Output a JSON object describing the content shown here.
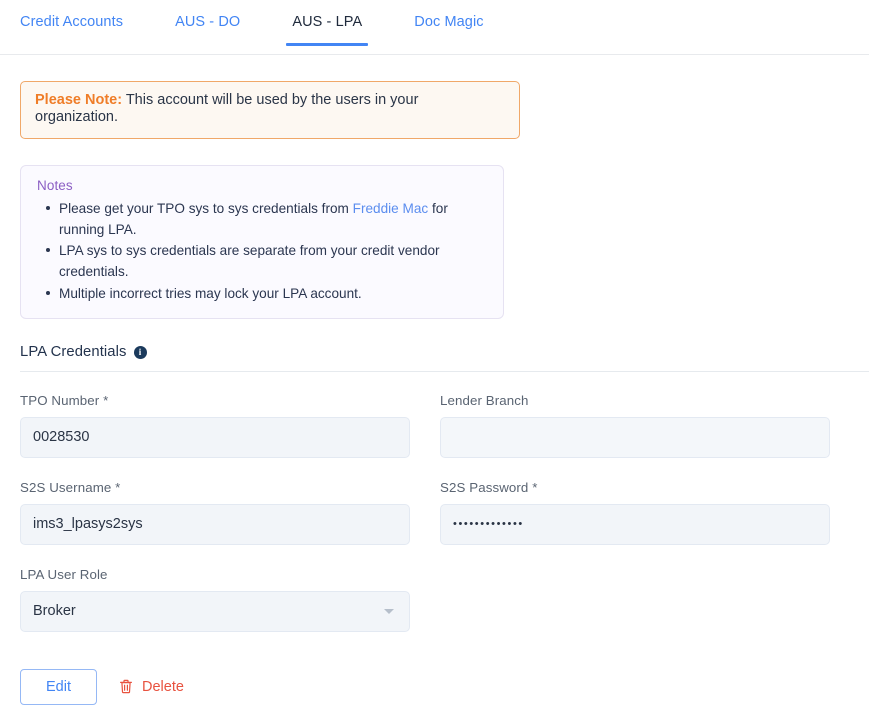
{
  "tabs": [
    {
      "label": "Credit Accounts",
      "active": false
    },
    {
      "label": "AUS - DO",
      "active": false
    },
    {
      "label": "AUS - LPA",
      "active": true
    },
    {
      "label": "Doc Magic",
      "active": false
    }
  ],
  "alert": {
    "prefix": "Please Note:",
    "message": "This account will be used by the users in your organization."
  },
  "notes": {
    "title": "Notes",
    "items": [
      {
        "before": "Please get your TPO sys to sys credentials from ",
        "link": "Freddie Mac",
        "after": " for running LPA."
      },
      {
        "before": "LPA sys to sys credentials are separate from your credit vendor credentials.",
        "link": "",
        "after": ""
      },
      {
        "before": "Multiple incorrect tries may lock your LPA account.",
        "link": "",
        "after": ""
      }
    ]
  },
  "section": {
    "title": "LPA Credentials",
    "info_icon": "info-icon",
    "info_glyph": "i"
  },
  "fields": {
    "tpo_number": {
      "label": "TPO Number *",
      "value": "0028530"
    },
    "lender_branch": {
      "label": "Lender Branch",
      "value": ""
    },
    "s2s_username": {
      "label": "S2S Username *",
      "value": "ims3_lpasys2sys"
    },
    "s2s_password": {
      "label": "S2S Password *",
      "value": "•••••••••••••"
    },
    "lpa_user_role": {
      "label": "LPA User Role",
      "value": "Broker"
    }
  },
  "actions": {
    "edit_label": "Edit",
    "delete_label": "Delete",
    "delete_icon": "trash-icon"
  },
  "colors": {
    "accent_blue": "#4285f4",
    "alert_orange": "#ef7d28",
    "notes_purple": "#8c5fc4",
    "link_blue": "#5b8def",
    "delete_red": "#e8523f",
    "field_bg": "#f2f5f9"
  }
}
